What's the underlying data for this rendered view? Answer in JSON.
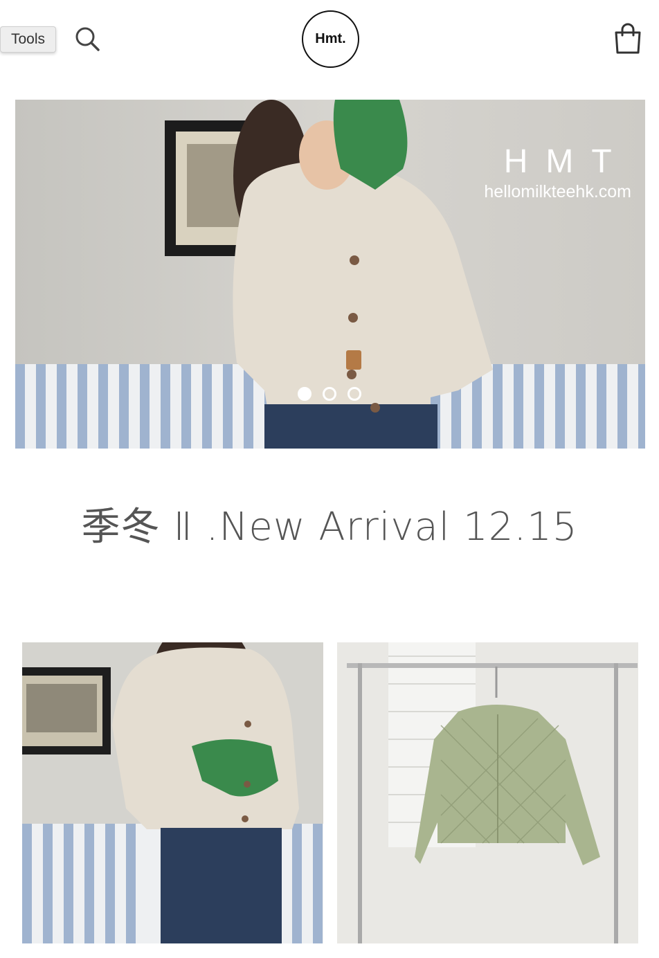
{
  "header": {
    "tools_label": "Tools",
    "search_icon": "search-icon",
    "logo_text": "Hmt.",
    "cart_icon": "shopping-bag-icon"
  },
  "hero": {
    "watermark_brand": "HMT",
    "watermark_site": "hellomilkteehk.com",
    "slides_total": 3,
    "active_slide": 1
  },
  "section": {
    "title": "季冬 Ⅱ .New Arrival 12.15"
  },
  "colors": {
    "sweater": "#e4ddd1",
    "glove_green": "#3a8a4c",
    "sofa_stripe": "#9fb3cf",
    "quilted_jacket": "#a9b58f"
  }
}
